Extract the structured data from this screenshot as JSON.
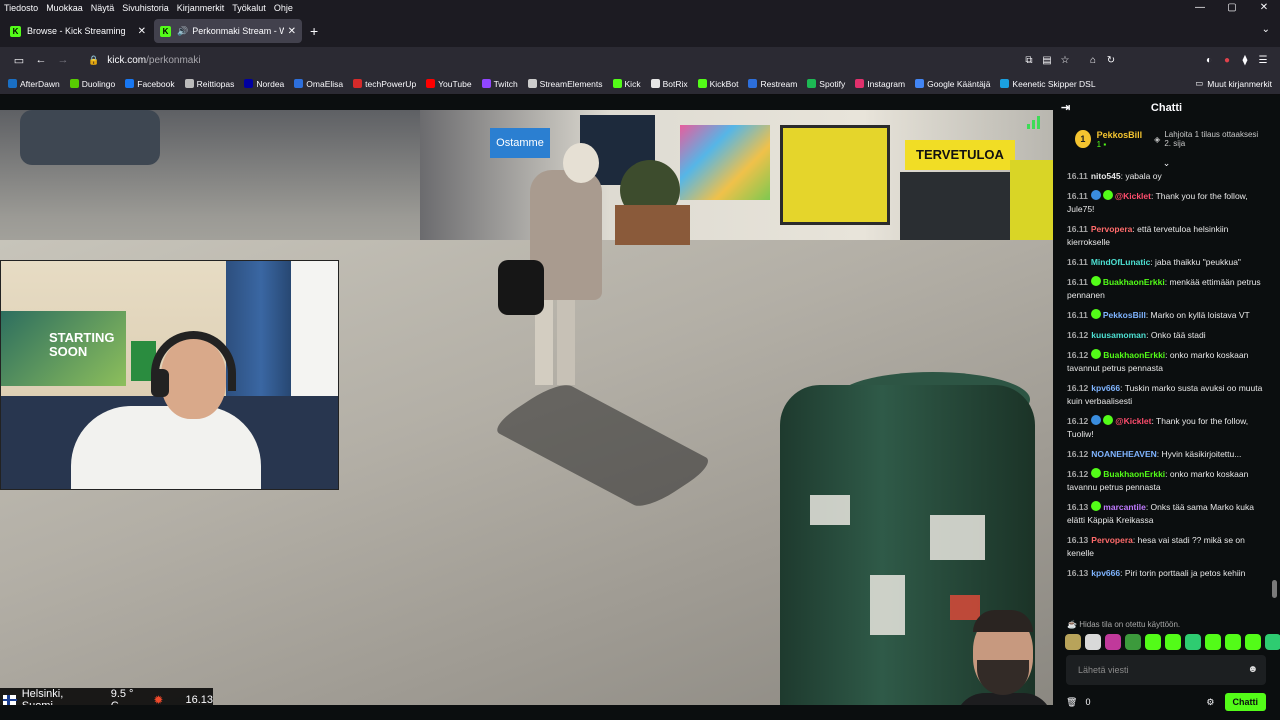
{
  "menu": [
    "Tiedosto",
    "Muokkaa",
    "Näytä",
    "Sivuhistoria",
    "Kirjanmerkit",
    "Työkalut",
    "Ohje"
  ],
  "tabs": [
    {
      "title": "Browse - Kick Streaming",
      "active": false
    },
    {
      "title": "Perkonmaki Stream - Watch",
      "active": true
    }
  ],
  "url": {
    "host": "kick.com",
    "path": "/perkonmaki"
  },
  "bookmarks": [
    {
      "label": "AfterDawn",
      "color": "#1a6fc4"
    },
    {
      "label": "Duolingo",
      "color": "#58cc02"
    },
    {
      "label": "Facebook",
      "color": "#1877f2"
    },
    {
      "label": "Reittiopas",
      "color": "#bbbbbb"
    },
    {
      "label": "Nordea",
      "color": "#0000a0"
    },
    {
      "label": "OmaElisa",
      "color": "#2d6fdc"
    },
    {
      "label": "techPowerUp",
      "color": "#d62a2a"
    },
    {
      "label": "YouTube",
      "color": "#ff0000"
    },
    {
      "label": "Twitch",
      "color": "#9146ff"
    },
    {
      "label": "StreamElements",
      "color": "#cccccc"
    },
    {
      "label": "Kick",
      "color": "#53fc18"
    },
    {
      "label": "BotRix",
      "color": "#e6e6e6"
    },
    {
      "label": "KickBot",
      "color": "#53fc18"
    },
    {
      "label": "Restream",
      "color": "#2d6fdc"
    },
    {
      "label": "Spotify",
      "color": "#1db954"
    },
    {
      "label": "Instagram",
      "color": "#e1306c"
    },
    {
      "label": "Google Kääntäjä",
      "color": "#4285f4"
    },
    {
      "label": "Keenetic Skipper DSL",
      "color": "#1aa0e0"
    }
  ],
  "other_bookmarks": "Muut kirjanmerkit",
  "video": {
    "shop_sign": "TERVETULOA",
    "sign_blue": "Ostamme",
    "poster": "STARTING SOON"
  },
  "overlay": {
    "location": "Helsinki, Suomi",
    "temp": "9.5 ° C",
    "time": "16.13"
  },
  "chat": {
    "title": "Chatti",
    "pinned": {
      "rank": "1",
      "name": "PekkosBill",
      "sub_count": "1",
      "gift": "Lahjoita 1 tilaus ottaaksesi 2. sija"
    },
    "messages": [
      {
        "time": "16.11",
        "user": "nito545",
        "color": "#e8e8e8",
        "badges": [],
        "text": "yabala oy"
      },
      {
        "time": "16.11",
        "user": "@Kicklet",
        "color": "#ff4d6d",
        "badges": [
          "#3a8dde",
          "#53fc18"
        ],
        "text": "Thank you for the follow, Jule75!"
      },
      {
        "time": "16.11",
        "user": "Pervopera",
        "color": "#ff6b6b",
        "badges": [],
        "text": "että tervetuloa helsinkiin kierrokselle"
      },
      {
        "time": "16.11",
        "user": "MindOfLunatic",
        "color": "#4de0d2",
        "badges": [],
        "text": "jaba thaikku \"peukkua\""
      },
      {
        "time": "16.11",
        "user": "BuakhaonErkki",
        "color": "#53fc18",
        "badges": [
          "#53fc18"
        ],
        "text": "menkää ettimään petrus pennanen"
      },
      {
        "time": "16.11",
        "user": "PekkosBill",
        "color": "#7fb4ff",
        "badges": [
          "#53fc18"
        ],
        "text": "Marko on kyllä loistava VT"
      },
      {
        "time": "16.12",
        "user": "kuusamoman",
        "color": "#4de0d2",
        "badges": [],
        "text": "Onko tää stadi"
      },
      {
        "time": "16.12",
        "user": "BuakhaonErkki",
        "color": "#53fc18",
        "badges": [
          "#53fc18"
        ],
        "text": "onko marko koskaan tavannut petrus pennasta"
      },
      {
        "time": "16.12",
        "user": "kpv666",
        "color": "#7fb4ff",
        "badges": [],
        "text": "Tuskin marko susta avuksi oo muuta kuin verbaalisesti"
      },
      {
        "time": "16.12",
        "user": "@Kicklet",
        "color": "#ff4d6d",
        "badges": [
          "#3a8dde",
          "#53fc18"
        ],
        "text": "Thank you for the follow, Tuoliw!"
      },
      {
        "time": "16.12",
        "user": "NOANEHEAVEN",
        "color": "#7fb4ff",
        "badges": [],
        "text": "Hyvin käsikirjoitettu..."
      },
      {
        "time": "16.12",
        "user": "BuakhaonErkki",
        "color": "#53fc18",
        "badges": [
          "#53fc18"
        ],
        "text": "onko marko koskaan tavannu petrus pennasta"
      },
      {
        "time": "16.13",
        "user": "marcantile",
        "color": "#c07bff",
        "badges": [
          "#53fc18"
        ],
        "text": "Onks tää sama Marko kuka elätti Käppiä Kreikassa"
      },
      {
        "time": "16.13",
        "user": "Pervopera",
        "color": "#ff6b6b",
        "badges": [],
        "text": "hesa vai stadi ?? mikä se on kenelle"
      },
      {
        "time": "16.13",
        "user": "kpv666",
        "color": "#7fb4ff",
        "badges": [],
        "text": "Piri torin porttaali ja petos kehiin"
      }
    ],
    "slow_mode": "Hidas tila on otettu käyttöön.",
    "emote_colors": [
      "#b8a35a",
      "#d9d9d9",
      "#c0399b",
      "#3c9a3c",
      "#53fc18",
      "#53fc18",
      "#2ecc71",
      "#53fc18",
      "#53fc18",
      "#53fc18",
      "#2ecc71",
      "#53fc18"
    ],
    "input_placeholder": "Lähetä viesti",
    "points": "0",
    "send_label": "Chatti"
  }
}
